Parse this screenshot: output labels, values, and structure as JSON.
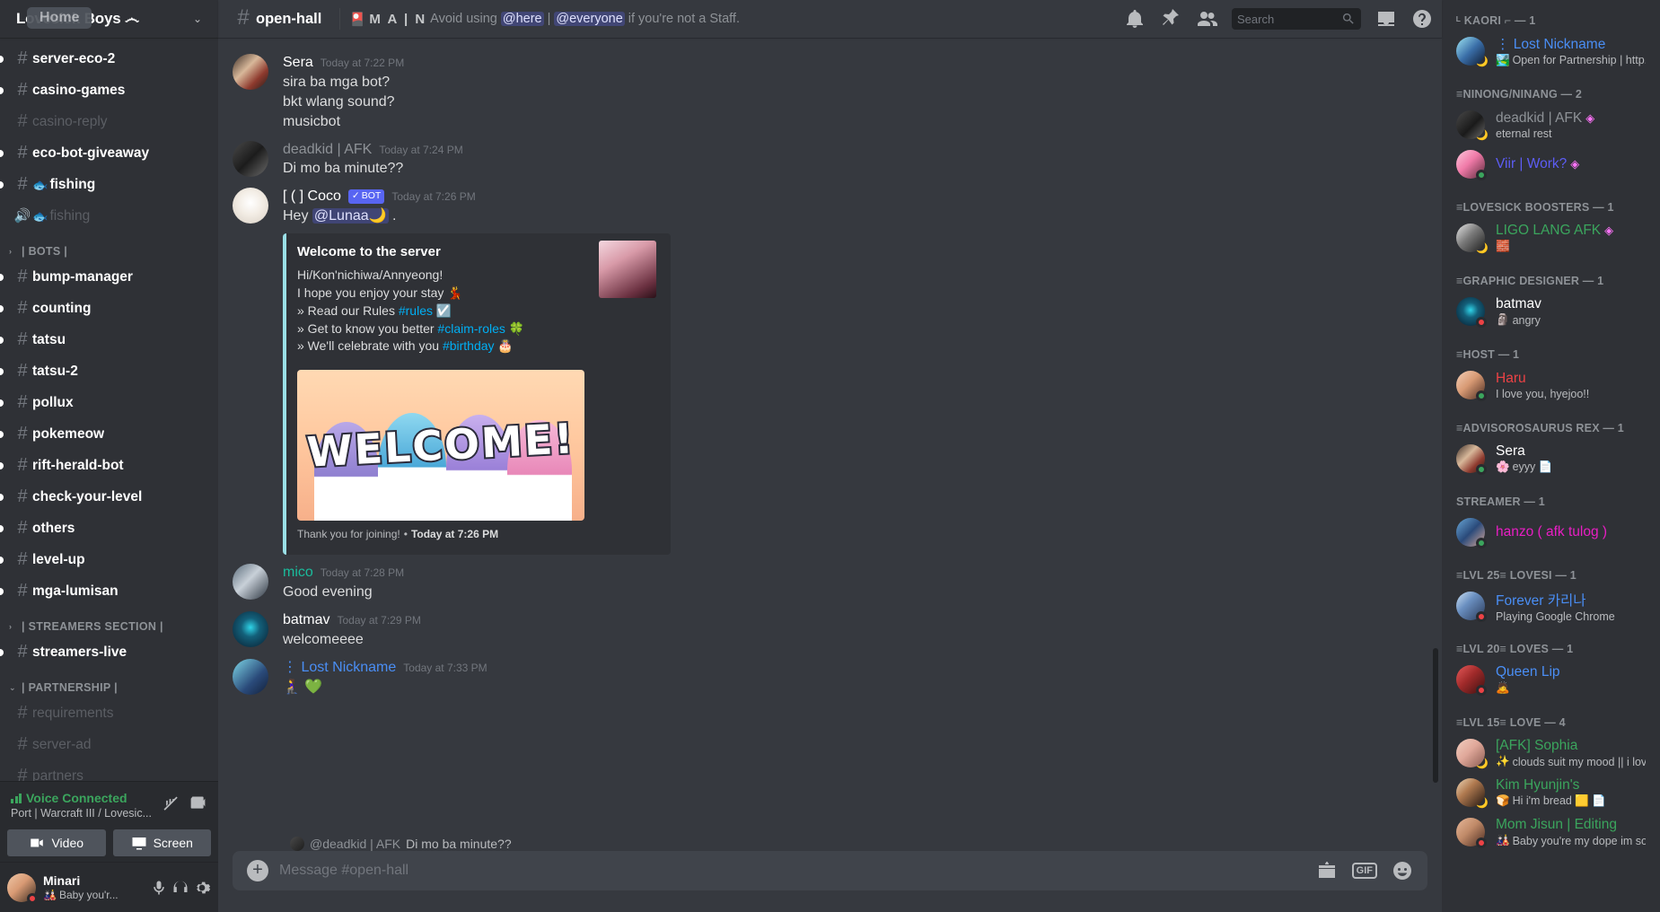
{
  "server": {
    "name": "Lovesick Boys ෴",
    "tooltip": "Home",
    "chevron": "⌄"
  },
  "sidebar": {
    "channels": [
      {
        "type": "text",
        "name": "server-eco-2",
        "state": "unread",
        "emoji": ""
      },
      {
        "type": "text",
        "name": "casino-games",
        "state": "unread",
        "emoji": ""
      },
      {
        "type": "text",
        "name": "casino-reply",
        "state": "muted",
        "emoji": ""
      },
      {
        "type": "text",
        "name": "eco-bot-giveaway",
        "state": "unread",
        "emoji": ""
      },
      {
        "type": "text",
        "name": "fishing",
        "state": "unread",
        "emoji": "🐟"
      },
      {
        "type": "voice",
        "name": "fishing",
        "state": "muted",
        "emoji": "🐟"
      }
    ],
    "categories": [
      {
        "label": "| BOTS |",
        "arrow": "›",
        "channels": [
          {
            "type": "text",
            "name": "bump-manager",
            "state": "unread"
          },
          {
            "type": "text",
            "name": "counting",
            "state": "unread"
          },
          {
            "type": "text",
            "name": "tatsu",
            "state": "unread"
          },
          {
            "type": "text",
            "name": "tatsu-2",
            "state": "unread"
          },
          {
            "type": "text",
            "name": "pollux",
            "state": "unread"
          },
          {
            "type": "text",
            "name": "pokemeow",
            "state": "unread"
          },
          {
            "type": "text",
            "name": "rift-herald-bot",
            "state": "unread"
          },
          {
            "type": "text",
            "name": "check-your-level",
            "state": "unread"
          },
          {
            "type": "text",
            "name": "others",
            "state": "unread"
          },
          {
            "type": "text",
            "name": "level-up",
            "state": "unread"
          },
          {
            "type": "text",
            "name": "mga-lumisan",
            "state": "unread"
          }
        ]
      },
      {
        "label": "| STREAMERS SECTION |",
        "arrow": "›",
        "channels": [
          {
            "type": "text",
            "name": "streamers-live",
            "state": "unread"
          }
        ]
      },
      {
        "label": "| PARTNERSHIP |",
        "arrow": "⌄",
        "channels": [
          {
            "type": "text",
            "name": "requirements",
            "state": "muted"
          },
          {
            "type": "text",
            "name": "server-ad",
            "state": "muted"
          },
          {
            "type": "text",
            "name": "partners",
            "state": "muted"
          }
        ]
      }
    ],
    "voice": {
      "status": "Voice Connected",
      "channel": "Port | Warcraft III / Lovesic...",
      "video_label": "Video",
      "screen_label": "Screen"
    },
    "user": {
      "name": "Minari",
      "status_text": "Baby you'r...",
      "status_emoji": "🎎",
      "presence": "dnd"
    }
  },
  "header": {
    "channel_name": "open-hall",
    "topic_emoji": "🎴",
    "topic_main": "M A | N",
    "topic_prefix": "Avoid using",
    "topic_here": "@here",
    "topic_sep": "|",
    "topic_everyone": "@everyone",
    "topic_suffix": "if you're not a Staff."
  },
  "search": {
    "placeholder": "Search"
  },
  "messages": [
    {
      "author": "Sera",
      "author_color": "#ffffff",
      "time": "Today at 7:22 PM",
      "avatar_bg": "linear-gradient(135deg,#3a2b24 0%,#d8b89a 40%,#8e3a2e 70%,#241c18 100%)",
      "lines": [
        "sira ba mga bot?",
        "bkt wlang sound?",
        "musicbot"
      ]
    },
    {
      "author": "deadkid | AFK",
      "author_color": "#8e9297",
      "time": "Today at 7:24 PM",
      "avatar_bg": "linear-gradient(135deg,#4a4a4a 0%,#1c1c1c 50%,#6b6b6b 100%)",
      "lines": [
        "Di mo ba minute??"
      ]
    }
  ],
  "bot_message": {
    "author": "[ ( ] Coco",
    "bot_tag": "BOT",
    "bot_check": "✓",
    "time": "Today at 7:26 PM",
    "greeting_prefix": "Hey",
    "mention": "@Lunaa🌙",
    "greeting_suffix": ".",
    "embed": {
      "title": "Welcome to the server",
      "line1": "Hi/Kon'nichiwa/Annyeong!",
      "line2": "I hope you enjoy your stay 💃",
      "line3_prefix": "» Read our Rules",
      "line3_link": "#rules",
      "line3_emoji": "☑️",
      "line4_prefix": "» Get to know you better",
      "line4_link": "#claim-roles",
      "line4_emoji": "🍀",
      "line5_prefix": "» We'll celebrate with you",
      "line5_link": "#birthday",
      "line5_emoji": "🎂",
      "art_text": "WELCOME!",
      "footer_text": "Thank you for joining!",
      "footer_sep": "•",
      "footer_time": "Today at 7:26 PM"
    }
  },
  "messages_after": [
    {
      "author": "mico",
      "author_color": "#1abc9c",
      "time": "Today at 7:28 PM",
      "avatar_bg": "linear-gradient(135deg,#5a6b7a 0%,#c8d0d8 45%,#2c3540 100%)",
      "lines": [
        "Good evening"
      ]
    },
    {
      "author": "batmav",
      "author_color": "#ffffff",
      "time": "Today at 7:29 PM",
      "avatar_bg": "radial-gradient(circle at 50% 45%,#2fd4e8 0%,#13607a 35%,#0a1c2e 100%)",
      "lines": [
        "welcomeeee"
      ]
    },
    {
      "author": "⋮ Lost Nickname",
      "author_color": "#4a8ef5",
      "time": "Today at 7:33 PM",
      "avatar_bg": "linear-gradient(135deg,#7fd8e8 0%,#2a4a7a 60%,#12203a 100%)",
      "lines": [
        "🧎‍♀️ 💚"
      ]
    }
  ],
  "reply_preview": {
    "mention": "@deadkid | AFK",
    "text": "Di mo ba minute??"
  },
  "composer": {
    "placeholder": "Message #open-hall",
    "gif_label": "GIF"
  },
  "member_list": [
    {
      "group": "ᴸ KAORI ⌐ — 1",
      "members": [
        {
          "name": "⋮ Lost Nickname",
          "color": "#4a8ef5",
          "sub": "Open for Partnership | http...",
          "sub_emoji": "🏞️",
          "presence": "idle",
          "badge": "",
          "avatar_bg": "linear-gradient(135deg,#9fe7f5 0%,#3a6ea8 50%,#0e1a30 100%)"
        }
      ]
    },
    {
      "group": "≡NINONG/NINANG — 2",
      "members": [
        {
          "name": "deadkid | AFK",
          "color": "#8e9297",
          "sub": "eternal rest",
          "sub_emoji": "",
          "presence": "idle",
          "badge": "◈",
          "avatar_bg": "linear-gradient(135deg,#4a4a4a 0%,#1a1a1a 55%,#6b6b6b 100%)"
        },
        {
          "name": "Viir | Work?",
          "color": "#5d5df6",
          "sub": "",
          "sub_emoji": "",
          "presence": "online",
          "badge": "◈",
          "avatar_bg": "linear-gradient(135deg,#ffc9dd 0%,#f07aa8 45%,#5a2a3a 100%)"
        }
      ]
    },
    {
      "group": "≡LOVESICK BOOSTERS — 1",
      "members": [
        {
          "name": "LIGO LANG AFK",
          "color": "#3ba55d",
          "sub": "",
          "sub_emoji": "🧱",
          "presence": "idle",
          "badge": "◈",
          "avatar_bg": "linear-gradient(135deg,#e8e8e8 0%,#7a7a7a 45%,#1c1c1c 100%)"
        }
      ]
    },
    {
      "group": "≡GRAPHIC DESIGNER — 1",
      "members": [
        {
          "name": "batmav",
          "color": "#ffffff",
          "sub": "angry",
          "sub_emoji": "🗿",
          "presence": "dnd",
          "badge": "",
          "avatar_bg": "radial-gradient(circle at 50% 45%,#2fd4e8 0%,#13607a 35%,#08182a 100%)"
        }
      ]
    },
    {
      "group": "≡HOST — 1",
      "members": [
        {
          "name": "Haru",
          "color": "#ed4245",
          "sub": "I love you, hyejoo!!",
          "sub_emoji": "",
          "presence": "online",
          "badge": "",
          "avatar_bg": "linear-gradient(135deg,#f5d0b8 0%,#d89a74 45%,#4a2a20 100%)"
        }
      ]
    },
    {
      "group": "≡ADVISOROSAURUS REX — 1",
      "members": [
        {
          "name": "Sera",
          "color": "#ffffff",
          "sub": "eyyy 📄",
          "sub_emoji": "🌸",
          "presence": "online",
          "badge": "",
          "avatar_bg": "linear-gradient(135deg,#3a2b24 0%,#d8b89a 40%,#8e3a2e 70%,#241c18 100%)"
        }
      ]
    },
    {
      "group": "STREAMER — 1",
      "members": [
        {
          "name": "hanzo ( afk tulog )",
          "color": "#e91ec4",
          "sub": "",
          "sub_emoji": "",
          "presence": "online",
          "badge": "",
          "avatar_bg": "linear-gradient(135deg,#6aa8d8 0%,#2a4a7a 50%,#d8a898 100%)"
        }
      ]
    },
    {
      "group": "≡LVL 25≡ LOVESI — 1",
      "members": [
        {
          "name": "Forever 카리나",
          "color": "#4a8ef5",
          "sub": "Playing Google Chrome",
          "sub_emoji": "",
          "presence": "dnd",
          "badge": "",
          "avatar_bg": "linear-gradient(135deg,#cfe4f7 0%,#6a8fc0 40%,#2a3a58 100%)"
        }
      ]
    },
    {
      "group": "≡LVL 20≡ LOVES — 1",
      "members": [
        {
          "name": "Queen Lip",
          "color": "#4a8ef5",
          "sub": "",
          "sub_emoji": "🙇",
          "presence": "dnd",
          "badge": "",
          "avatar_bg": "linear-gradient(135deg,#e85a5a 0%,#a02a2a 45%,#3a1010 100%)"
        }
      ]
    },
    {
      "group": "≡LVL 15≡ LOVE — 4",
      "members": [
        {
          "name": "[AFK] Sophia",
          "color": "#3ba55d",
          "sub": "clouds suit my mood || i lov...",
          "sub_emoji": "✨",
          "presence": "idle",
          "badge": "",
          "avatar_bg": "linear-gradient(135deg,#f3cfc0 0%,#e0a89a 45%,#8a5a50 100%)"
        },
        {
          "name": "Kim Hyunjin's",
          "color": "#3ba55d",
          "sub": "Hi i'm bread 🟨 📄",
          "sub_emoji": "🍞",
          "presence": "idle",
          "badge": "",
          "avatar_bg": "linear-gradient(135deg,#f0d8b8 0%,#b07a50 40%,#201510 100%)"
        },
        {
          "name": "Mom Jisun | Editing",
          "color": "#3ba55d",
          "sub": "Baby you're my dope im so ...",
          "sub_emoji": "🎎",
          "presence": "dnd",
          "badge": "",
          "avatar_bg": "linear-gradient(135deg,#e8b89a 0%,#c08a68 45%,#4a2a20 100%)"
        }
      ]
    }
  ]
}
